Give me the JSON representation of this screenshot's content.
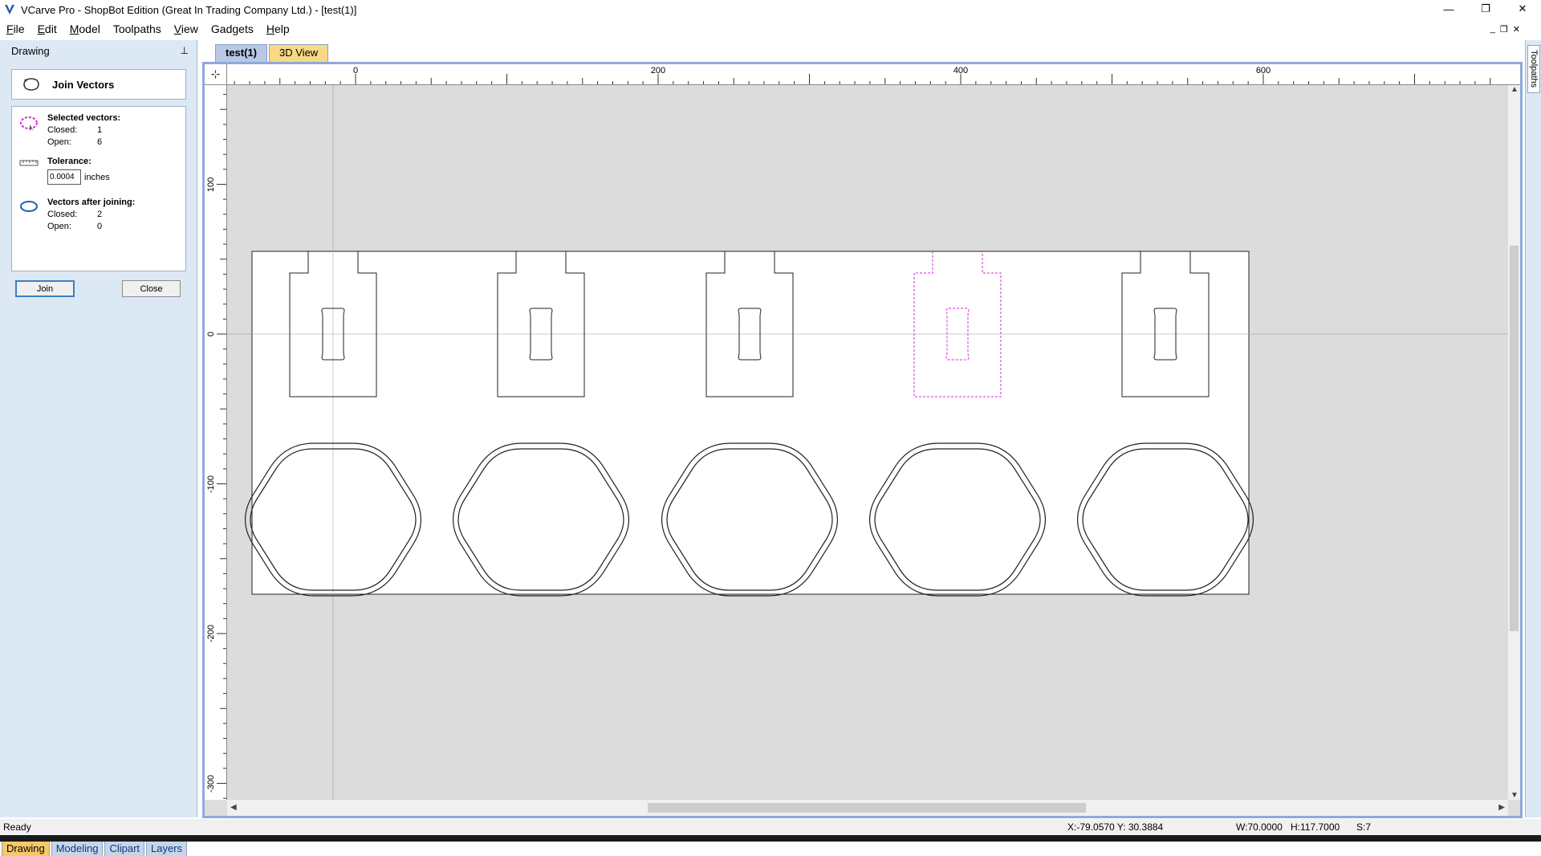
{
  "window": {
    "title": "VCarve Pro - ShopBot Edition (Great In Trading Company Ltd.) - [test(1)]",
    "minimize_glyph": "—",
    "restore_glyph": "❐",
    "close_glyph": "✕"
  },
  "menu": {
    "items": [
      {
        "label": "File",
        "underline": "F",
        "rest": "ile"
      },
      {
        "label": "Edit",
        "underline": "E",
        "rest": "dit"
      },
      {
        "label": "Model",
        "underline": "M",
        "rest": "odel"
      },
      {
        "label": "Toolpaths",
        "underline": "",
        "rest": "Toolpaths"
      },
      {
        "label": "View",
        "underline": "V",
        "rest": "iew"
      },
      {
        "label": "Gadgets",
        "underline": "",
        "rest": "Gadgets"
      },
      {
        "label": "Help",
        "underline": "H",
        "rest": "elp"
      }
    ],
    "mdi_minimize": "_",
    "mdi_restore": "❐",
    "mdi_close": "✕"
  },
  "left_panel": {
    "header": "Drawing",
    "pin_glyph": "⊥",
    "tool_title": "Join Vectors",
    "selected_title": "Selected vectors:",
    "selected_closed_label": "Closed:",
    "selected_closed_value": "1",
    "selected_open_label": "Open:",
    "selected_open_value": "6",
    "tolerance_title": "Tolerance:",
    "tolerance_value": "0.0004",
    "tolerance_unit": "inches",
    "after_title": "Vectors after joining:",
    "after_closed_label": "Closed:",
    "after_closed_value": "2",
    "after_open_label": "Open:",
    "after_open_value": "0",
    "join_button": "Join",
    "close_button": "Close",
    "bottom_tabs": [
      "Drawing",
      "Modeling",
      "Clipart",
      "Layers"
    ]
  },
  "doc_tabs": [
    "test(1)",
    "3D View"
  ],
  "rulers": {
    "top_labels": [
      "0",
      "200",
      "400",
      "600"
    ],
    "left_labels": [
      "100",
      "0",
      "-100",
      "-200",
      "-300"
    ]
  },
  "right_strip": {
    "tab": "Toolpaths"
  },
  "status": {
    "ready": "Ready",
    "xy": "X:-79.0570 Y: 30.3884",
    "w": "W:70.0000",
    "h": "H:117.7000",
    "s": "S:7"
  },
  "colors": {
    "selection": "#e020e0",
    "panel_bg": "#dde8f5",
    "canvas_bg": "#dcdcdc",
    "active_tab": "#f7c76a"
  }
}
